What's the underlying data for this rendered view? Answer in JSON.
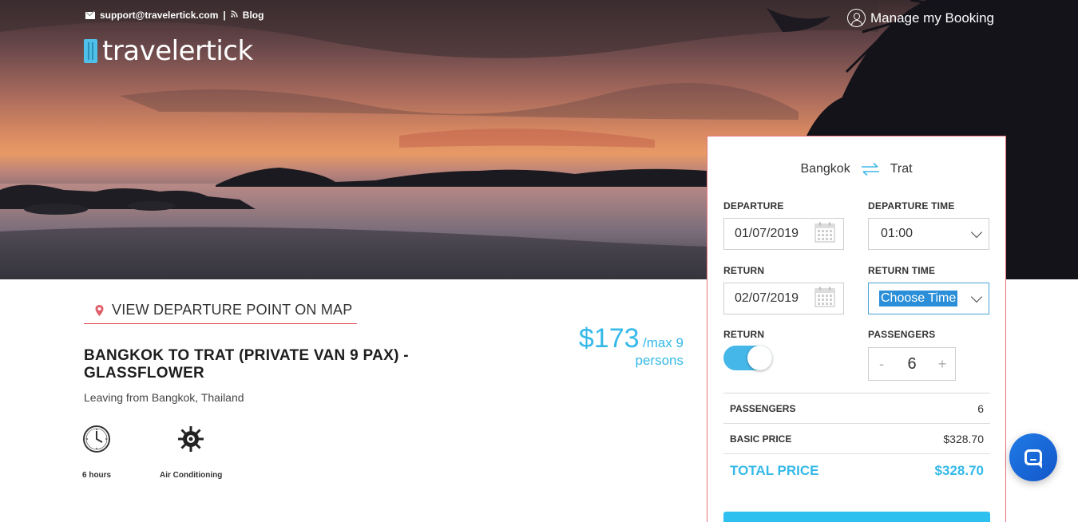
{
  "header": {
    "email": "support@travelertick.com",
    "separator": "|",
    "blog": "Blog",
    "logo_text": "travelertick",
    "manage_booking": "Manage my Booking"
  },
  "icons": {
    "mail": "mail-icon",
    "rss": "rss-icon",
    "user": "user-icon",
    "pin": "map-pin-icon",
    "swap": "swap-arrows-icon",
    "calendar": "calendar-icon",
    "clock": "clock-icon",
    "snowflake": "snowflake-icon",
    "chat": "chat-icon"
  },
  "trip": {
    "map_link": "VIEW DEPARTURE POINT ON MAP",
    "title": "BANGKOK TO TRAT (PRIVATE VAN 9 PAX) - GLASSFLOWER",
    "leaving": "Leaving from Bangkok, Thailand",
    "features": [
      {
        "label": "6 hours",
        "icon": "clock-icon"
      },
      {
        "label": "Air Conditioning",
        "icon": "snowflake-icon"
      }
    ],
    "price": "$173",
    "price_unit": "/max 9",
    "price_persons": "persons"
  },
  "booking": {
    "from": "Bangkok",
    "to": "Trat",
    "departure_label": "DEPARTURE",
    "departure_value": "01/07/2019",
    "departure_time_label": "DEPARTURE TIME",
    "departure_time_value": "01:00",
    "return_label": "RETURN",
    "return_value": "02/07/2019",
    "return_time_label": "RETURN TIME",
    "return_time_value": "Choose Time",
    "return_toggle_label": "RETURN",
    "return_toggle_on": true,
    "passengers_label": "PASSENGERS",
    "passengers_minus": "-",
    "passengers_value": "6",
    "passengers_plus": "+",
    "summary": {
      "passengers_label": "PASSENGERS",
      "passengers_value": "6",
      "basic_price_label": "BASIC PRICE",
      "basic_price_value": "$328.70",
      "total_label": "TOTAL PRICE",
      "total_value": "$328.70"
    }
  },
  "colors": {
    "accent": "#35b9e9",
    "panel_border": "#e8727a",
    "chat_button": "#1f6fe0"
  }
}
